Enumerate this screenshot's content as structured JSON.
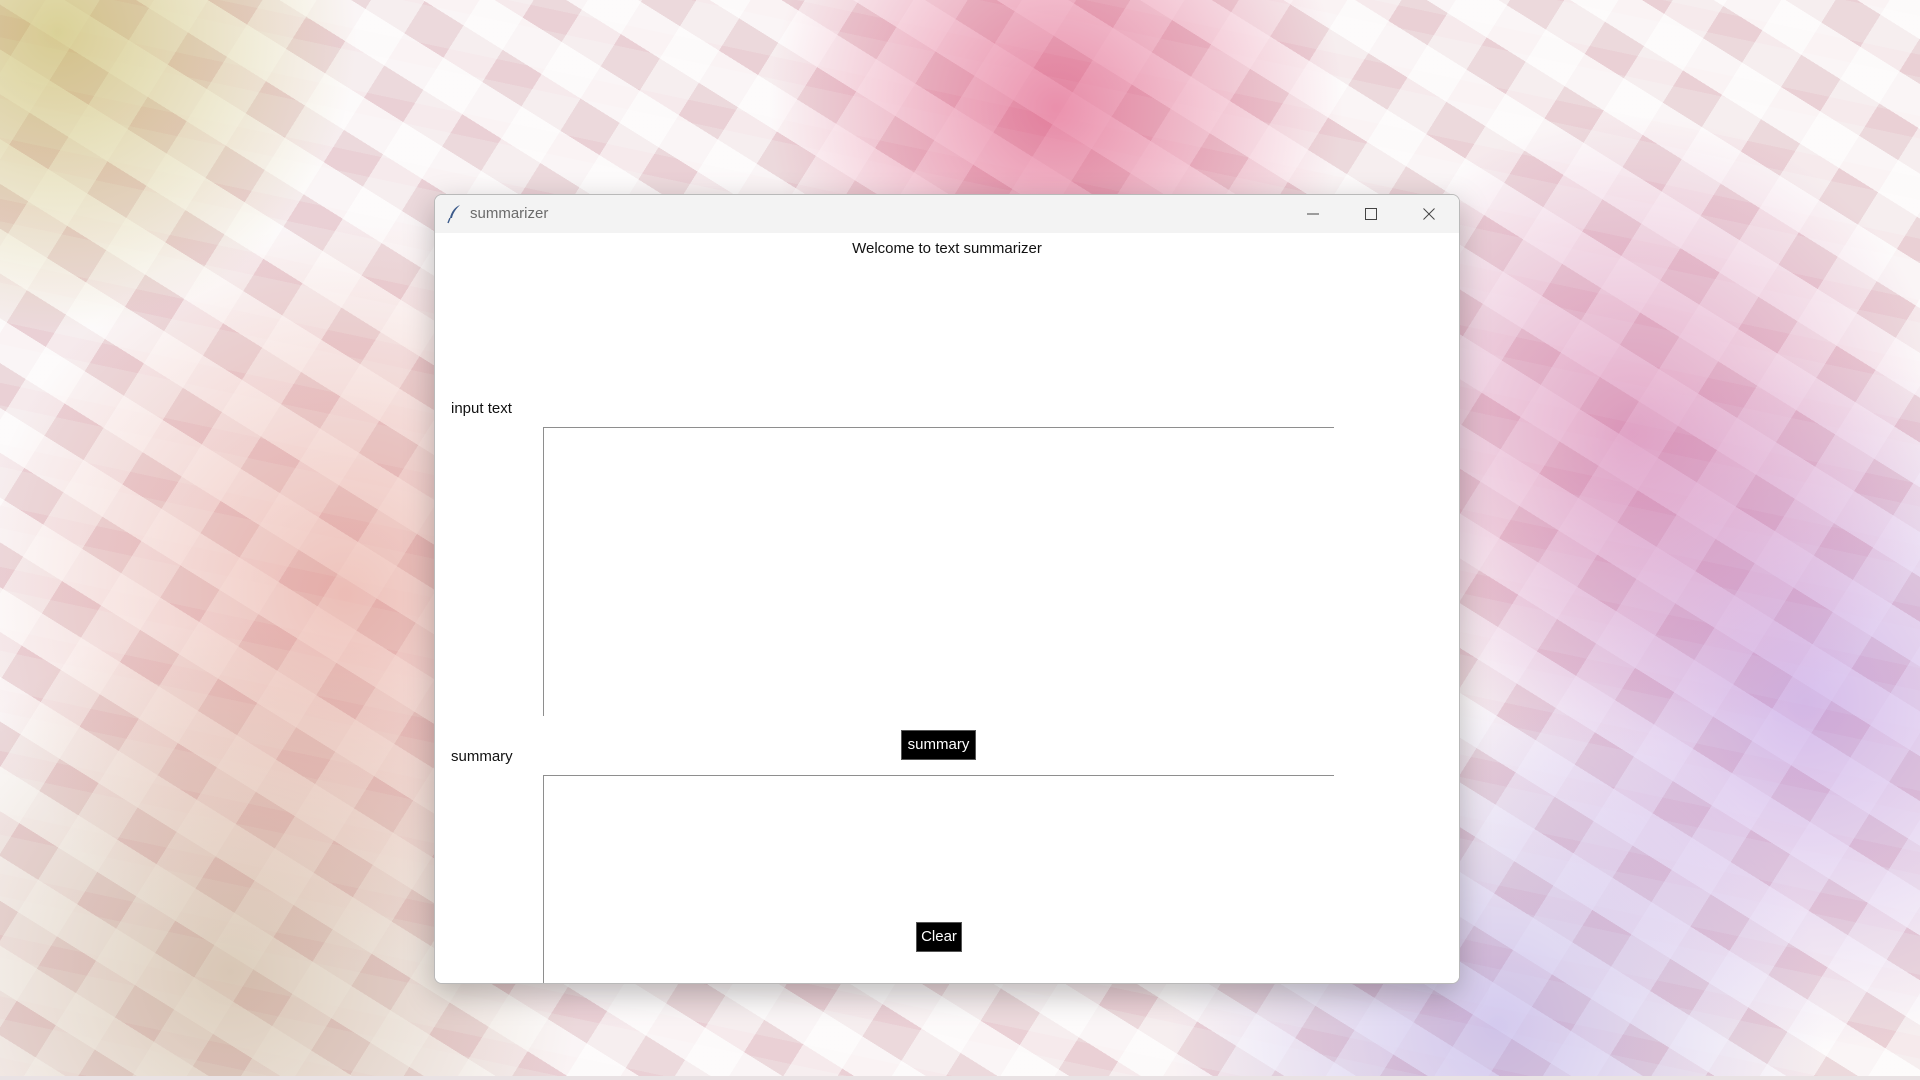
{
  "window": {
    "title": "summarizer",
    "icon": "feather-icon"
  },
  "caption_buttons": {
    "minimize_icon": "minimize-icon",
    "maximize_icon": "maximize-icon",
    "close_icon": "close-icon"
  },
  "main": {
    "welcome_text": "Welcome to text summarizer",
    "input_label": "input text",
    "input_value": "",
    "summary_button_label": "summary",
    "summary_label": "summary",
    "summary_value": "",
    "clear_button_label": "Clear"
  },
  "colors": {
    "button_background": "#000000",
    "button_text": "#ffffff",
    "titlebar": "#f3f3f3"
  }
}
